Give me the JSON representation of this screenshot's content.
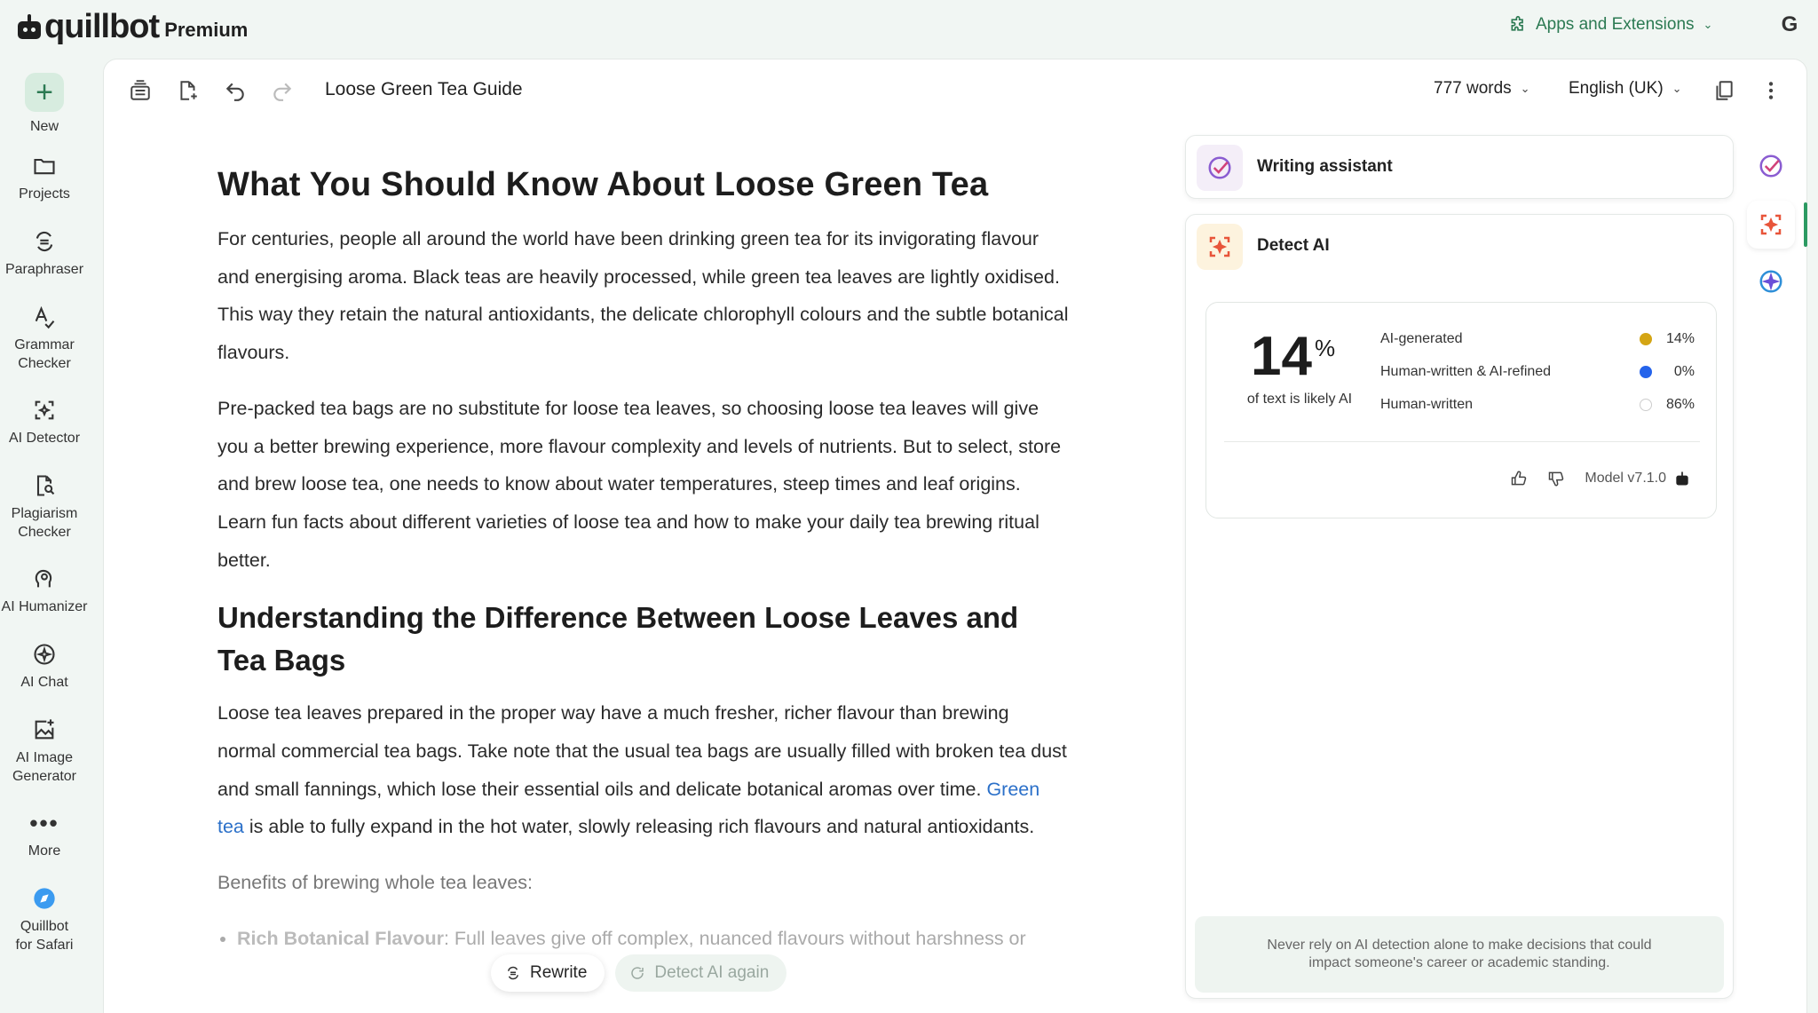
{
  "topbar": {
    "logo_text": "quillbot",
    "logo_premium": "Premium",
    "apps_label": "Apps and Extensions",
    "avatar_letter": "G"
  },
  "sidebar": {
    "items": [
      {
        "label": "New"
      },
      {
        "label": "Projects"
      },
      {
        "label": "Paraphraser"
      },
      {
        "label": "Grammar Checker"
      },
      {
        "label": "AI Detector"
      },
      {
        "label": "Plagiarism Checker"
      },
      {
        "label": "AI Humanizer"
      },
      {
        "label": "AI Chat"
      },
      {
        "label": "AI Image Generator"
      },
      {
        "label": "More"
      },
      {
        "label": "Quillbot for Safari"
      }
    ]
  },
  "toolbar": {
    "doc_title": "Loose Green Tea Guide",
    "word_count": "777 words",
    "language": "English (UK)"
  },
  "document": {
    "h1": "What You Should Know About Loose Green Tea",
    "p1": "For centuries, people all around the world have been drinking green tea for its invigorating flavour and energising aroma. Black teas are heavily processed, while green tea leaves are lightly oxidised. This way they retain the natural antioxidants, the delicate chlorophyll colours and the subtle botanical flavours.",
    "p2": "Pre-packed tea bags are no substitute for loose tea leaves, so choosing loose tea leaves will give you a better brewing experience, more flavour complexity and levels of nutrients. But to select, store and brew loose tea, one needs to know about water temperatures, steep times and leaf origins. Learn fun facts about different varieties of loose tea and how to make your daily tea brewing ritual better.",
    "h2": "Understanding the Difference Between Loose Leaves and Tea Bags",
    "p3_start": "Loose tea leaves prepared in the proper way have a much fresher, richer flavour than brewing normal commercial tea bags. Take note that the usual tea bags are usually filled with broken tea dust and small fannings, which lose their essential oils and delicate botanical aromas over time.",
    "p3_link": "Green tea",
    "p3_end": " is able to fully expand in the hot water, slowly releasing rich flavours and natural antioxidants.",
    "p4": "Benefits of brewing whole tea leaves:",
    "bullet_bold": "Rich Botanical Flavour",
    "bullet_text": ": Full leaves give off complex, nuanced flavours without harshness or"
  },
  "float_buttons": {
    "rewrite": "Rewrite",
    "detect_again": "Detect AI again"
  },
  "writing_assistant": {
    "title": "Writing assistant"
  },
  "detect_ai": {
    "title": "Detect AI",
    "score": "14",
    "score_unit": "%",
    "score_label": "of text is likely AI",
    "legend": [
      {
        "label": "AI-generated",
        "value": "14%",
        "color": "#d4a514"
      },
      {
        "label": "Human-written & AI-refined",
        "value": "0%",
        "color": "#2463eb"
      },
      {
        "label": "Human-written",
        "value": "86%",
        "color": "#ffffff"
      }
    ],
    "model": "Model v7.1.0",
    "notice": "Never rely on AI detection alone to make decisions that could impact someone's career or academic standing."
  },
  "colors": {
    "brand_green": "#2c7a53",
    "link_blue": "#2b70c9",
    "ai_yellow": "#d4a514",
    "refined_blue": "#2463eb"
  }
}
